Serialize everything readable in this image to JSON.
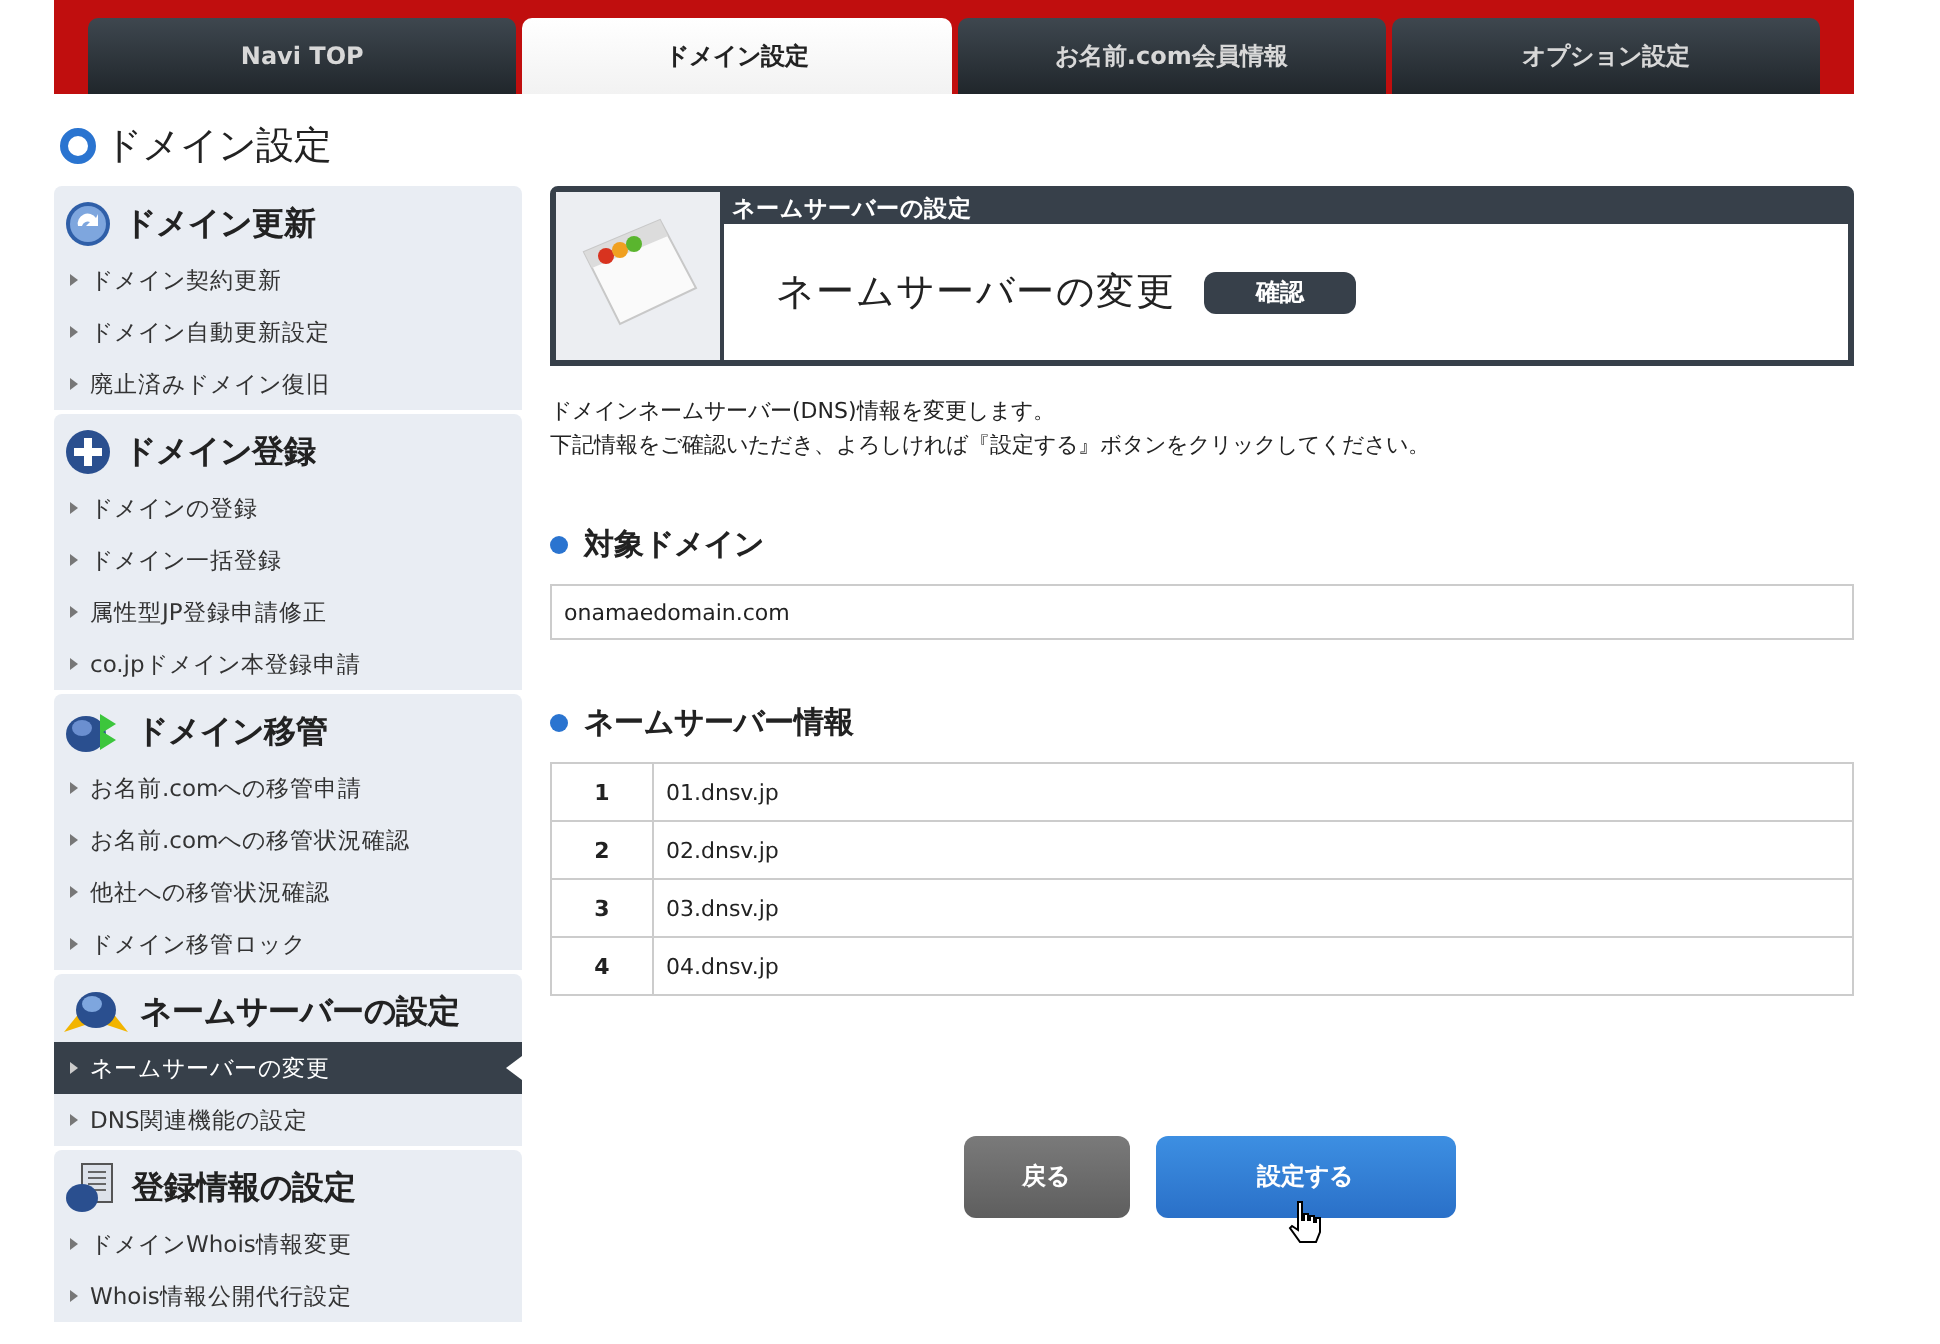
{
  "tabs": [
    {
      "label": "Navi TOP",
      "selected": false
    },
    {
      "label": "ドメイン設定",
      "selected": true
    },
    {
      "label": "お名前.com会員情報",
      "selected": false
    },
    {
      "label": "オプション設定",
      "selected": false
    }
  ],
  "page_title": "ドメイン設定",
  "sidebar": {
    "groups": [
      {
        "title": "ドメイン更新",
        "items": [
          {
            "label": "ドメイン契約更新",
            "selected": false
          },
          {
            "label": "ドメイン自動更新設定",
            "selected": false
          },
          {
            "label": "廃止済みドメイン復旧",
            "selected": false
          }
        ]
      },
      {
        "title": "ドメイン登録",
        "items": [
          {
            "label": "ドメインの登録",
            "selected": false
          },
          {
            "label": "ドメイン一括登録",
            "selected": false
          },
          {
            "label": "属性型JP登録申請修正",
            "selected": false
          },
          {
            "label": "co.jpドメイン本登録申請",
            "selected": false
          }
        ]
      },
      {
        "title": "ドメイン移管",
        "items": [
          {
            "label": "お名前.comへの移管申請",
            "selected": false
          },
          {
            "label": "お名前.comへの移管状況確認",
            "selected": false
          },
          {
            "label": "他社への移管状況確認",
            "selected": false
          },
          {
            "label": "ドメイン移管ロック",
            "selected": false
          }
        ]
      },
      {
        "title": "ネームサーバーの設定",
        "items": [
          {
            "label": "ネームサーバーの変更",
            "selected": true
          },
          {
            "label": "DNS関連機能の設定",
            "selected": false
          }
        ]
      },
      {
        "title": "登録情報の設定",
        "items": [
          {
            "label": "ドメインWhois情報変更",
            "selected": false
          },
          {
            "label": "Whois情報公開代行設定",
            "selected": false
          }
        ]
      }
    ]
  },
  "header": {
    "category": "ネームサーバーの設定",
    "title": "ネームサーバーの変更",
    "badge": "確認"
  },
  "description": [
    "ドメインネームサーバー(DNS)情報を変更します。",
    "下記情報をご確認いただき、よろしければ『設定する』ボタンをクリックしてください。"
  ],
  "target_domain": {
    "heading": "対象ドメイン",
    "value": "onamaedomain.com"
  },
  "nameservers": {
    "heading": "ネームサーバー情報",
    "rows": [
      {
        "number": "1",
        "host": "01.dnsv.jp"
      },
      {
        "number": "2",
        "host": "02.dnsv.jp"
      },
      {
        "number": "3",
        "host": "03.dnsv.jp"
      },
      {
        "number": "4",
        "host": "04.dnsv.jp"
      }
    ]
  },
  "buttons": [
    {
      "label": "戻る",
      "kind": "back"
    },
    {
      "label": "設定する",
      "kind": "primary"
    }
  ]
}
